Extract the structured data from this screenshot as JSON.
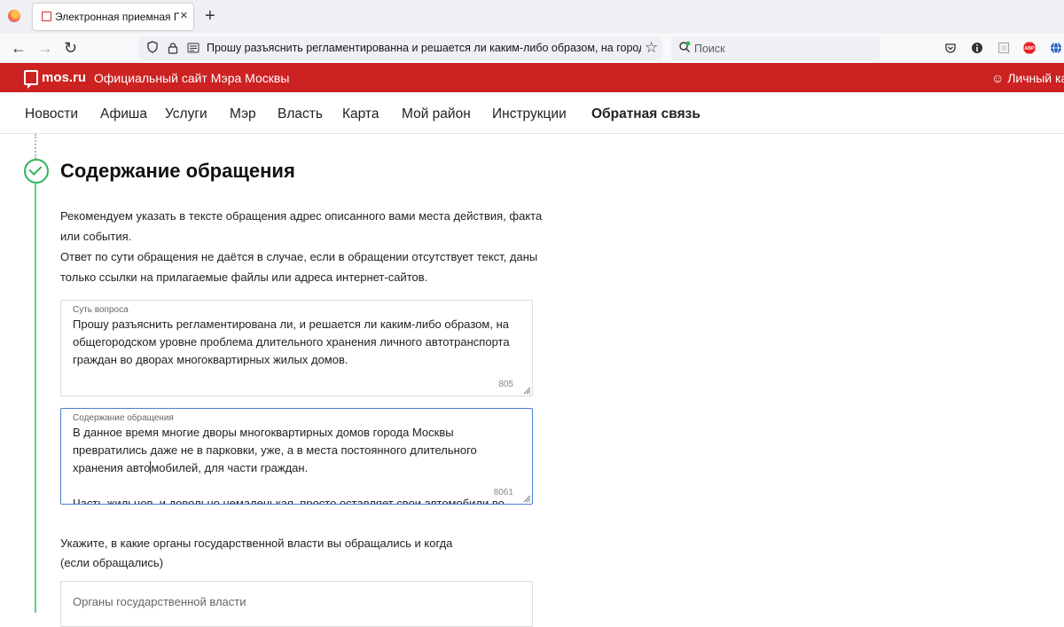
{
  "browser": {
    "tab_title": "Электронная приемная Правительства Москвы",
    "url": "Прошу разъяснить регламентированна и решается ли каким-либо образом, на городском уровне",
    "search_placeholder": "Поиск"
  },
  "site": {
    "name": "mos.ru",
    "tagline": "Официальный сайт Мэра Москвы",
    "account": "Личный кабинет",
    "brand_color": "#cc2222"
  },
  "nav": {
    "items": [
      "Новости",
      "Афиша",
      "Услуги",
      "Мэр",
      "Власть",
      "Карта",
      "Мой район",
      "Инструкции",
      "Обратная связь"
    ],
    "active": "Обратная связь"
  },
  "section": {
    "title": "Содержание обращения",
    "help_lines": [
      "Рекомендуем указать в тексте обращения адрес описанного вами места действия, факта",
      "или события.",
      "Ответ по сути обращения не даётся в случае, если в обращении отсутствует текст, даны",
      "только ссылки на прилагаемые файлы или адреса интернет-сайтов."
    ],
    "subject": {
      "label": "Суть вопроса",
      "value": "Прошу разъяснить регламентирована ли, и решается ли каким-либо образом, на общегородском уровне проблема длительного хранения личного автотранспорта граждан во дворах многоквартирных жилых домов.",
      "counter": "805"
    },
    "content": {
      "label": "Содержание обращения",
      "value_p1_a": "В данное время многие дворы многоквартирных домов города Москвы превратились даже не в парковки, уже, а в места постоянного длительного хранения авто",
      "value_p1_b": "мобилей, для части граждан.",
      "value_p2": "Часть жильцов, и довольно немаленькая, просто оставляет свои автомобили во дворах на длительное время.",
      "counter": "8061"
    },
    "question": {
      "line1": "Укажите, в какие органы государственной власти вы обращались и когда",
      "line2": "(если обращались)"
    },
    "authorities": {
      "placeholder": "Органы государственной власти"
    }
  }
}
